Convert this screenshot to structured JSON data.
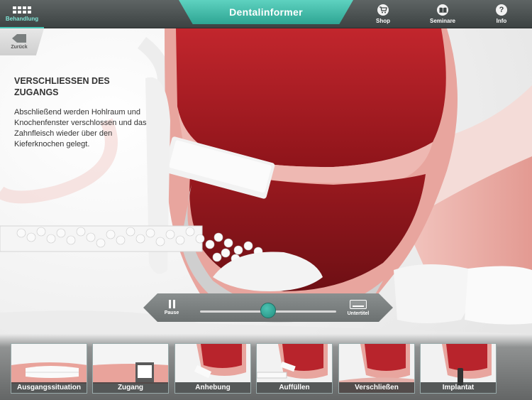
{
  "app": {
    "title": "Dentalinformer"
  },
  "topbar": {
    "behandlung_label": "Behandlung",
    "shop_label": "Shop",
    "seminare_label": "Seminare",
    "info_label": "Info"
  },
  "back": {
    "label": "Zurück"
  },
  "content": {
    "heading": "VERSCHLIESSEN DES ZUGANGS",
    "description": "Abschließend werden Hohlraum und Knochenfenster verschlossen und das Zahnfleisch wieder über den Kieferknochen gelegt."
  },
  "player": {
    "pause_label": "Pause",
    "subtitle_label": "Untertitel",
    "progress": 0.5
  },
  "chapters": [
    {
      "label": "Ausgangssituation"
    },
    {
      "label": "Zugang"
    },
    {
      "label": "Anhebung"
    },
    {
      "label": "Auffüllen"
    },
    {
      "label": "Verschließen"
    },
    {
      "label": "Implantat"
    }
  ],
  "colors": {
    "accent": "#36b4a3",
    "topbar": "#4a5050",
    "tissue_red": "#b8242c",
    "gum_pink": "#e8a59e"
  }
}
